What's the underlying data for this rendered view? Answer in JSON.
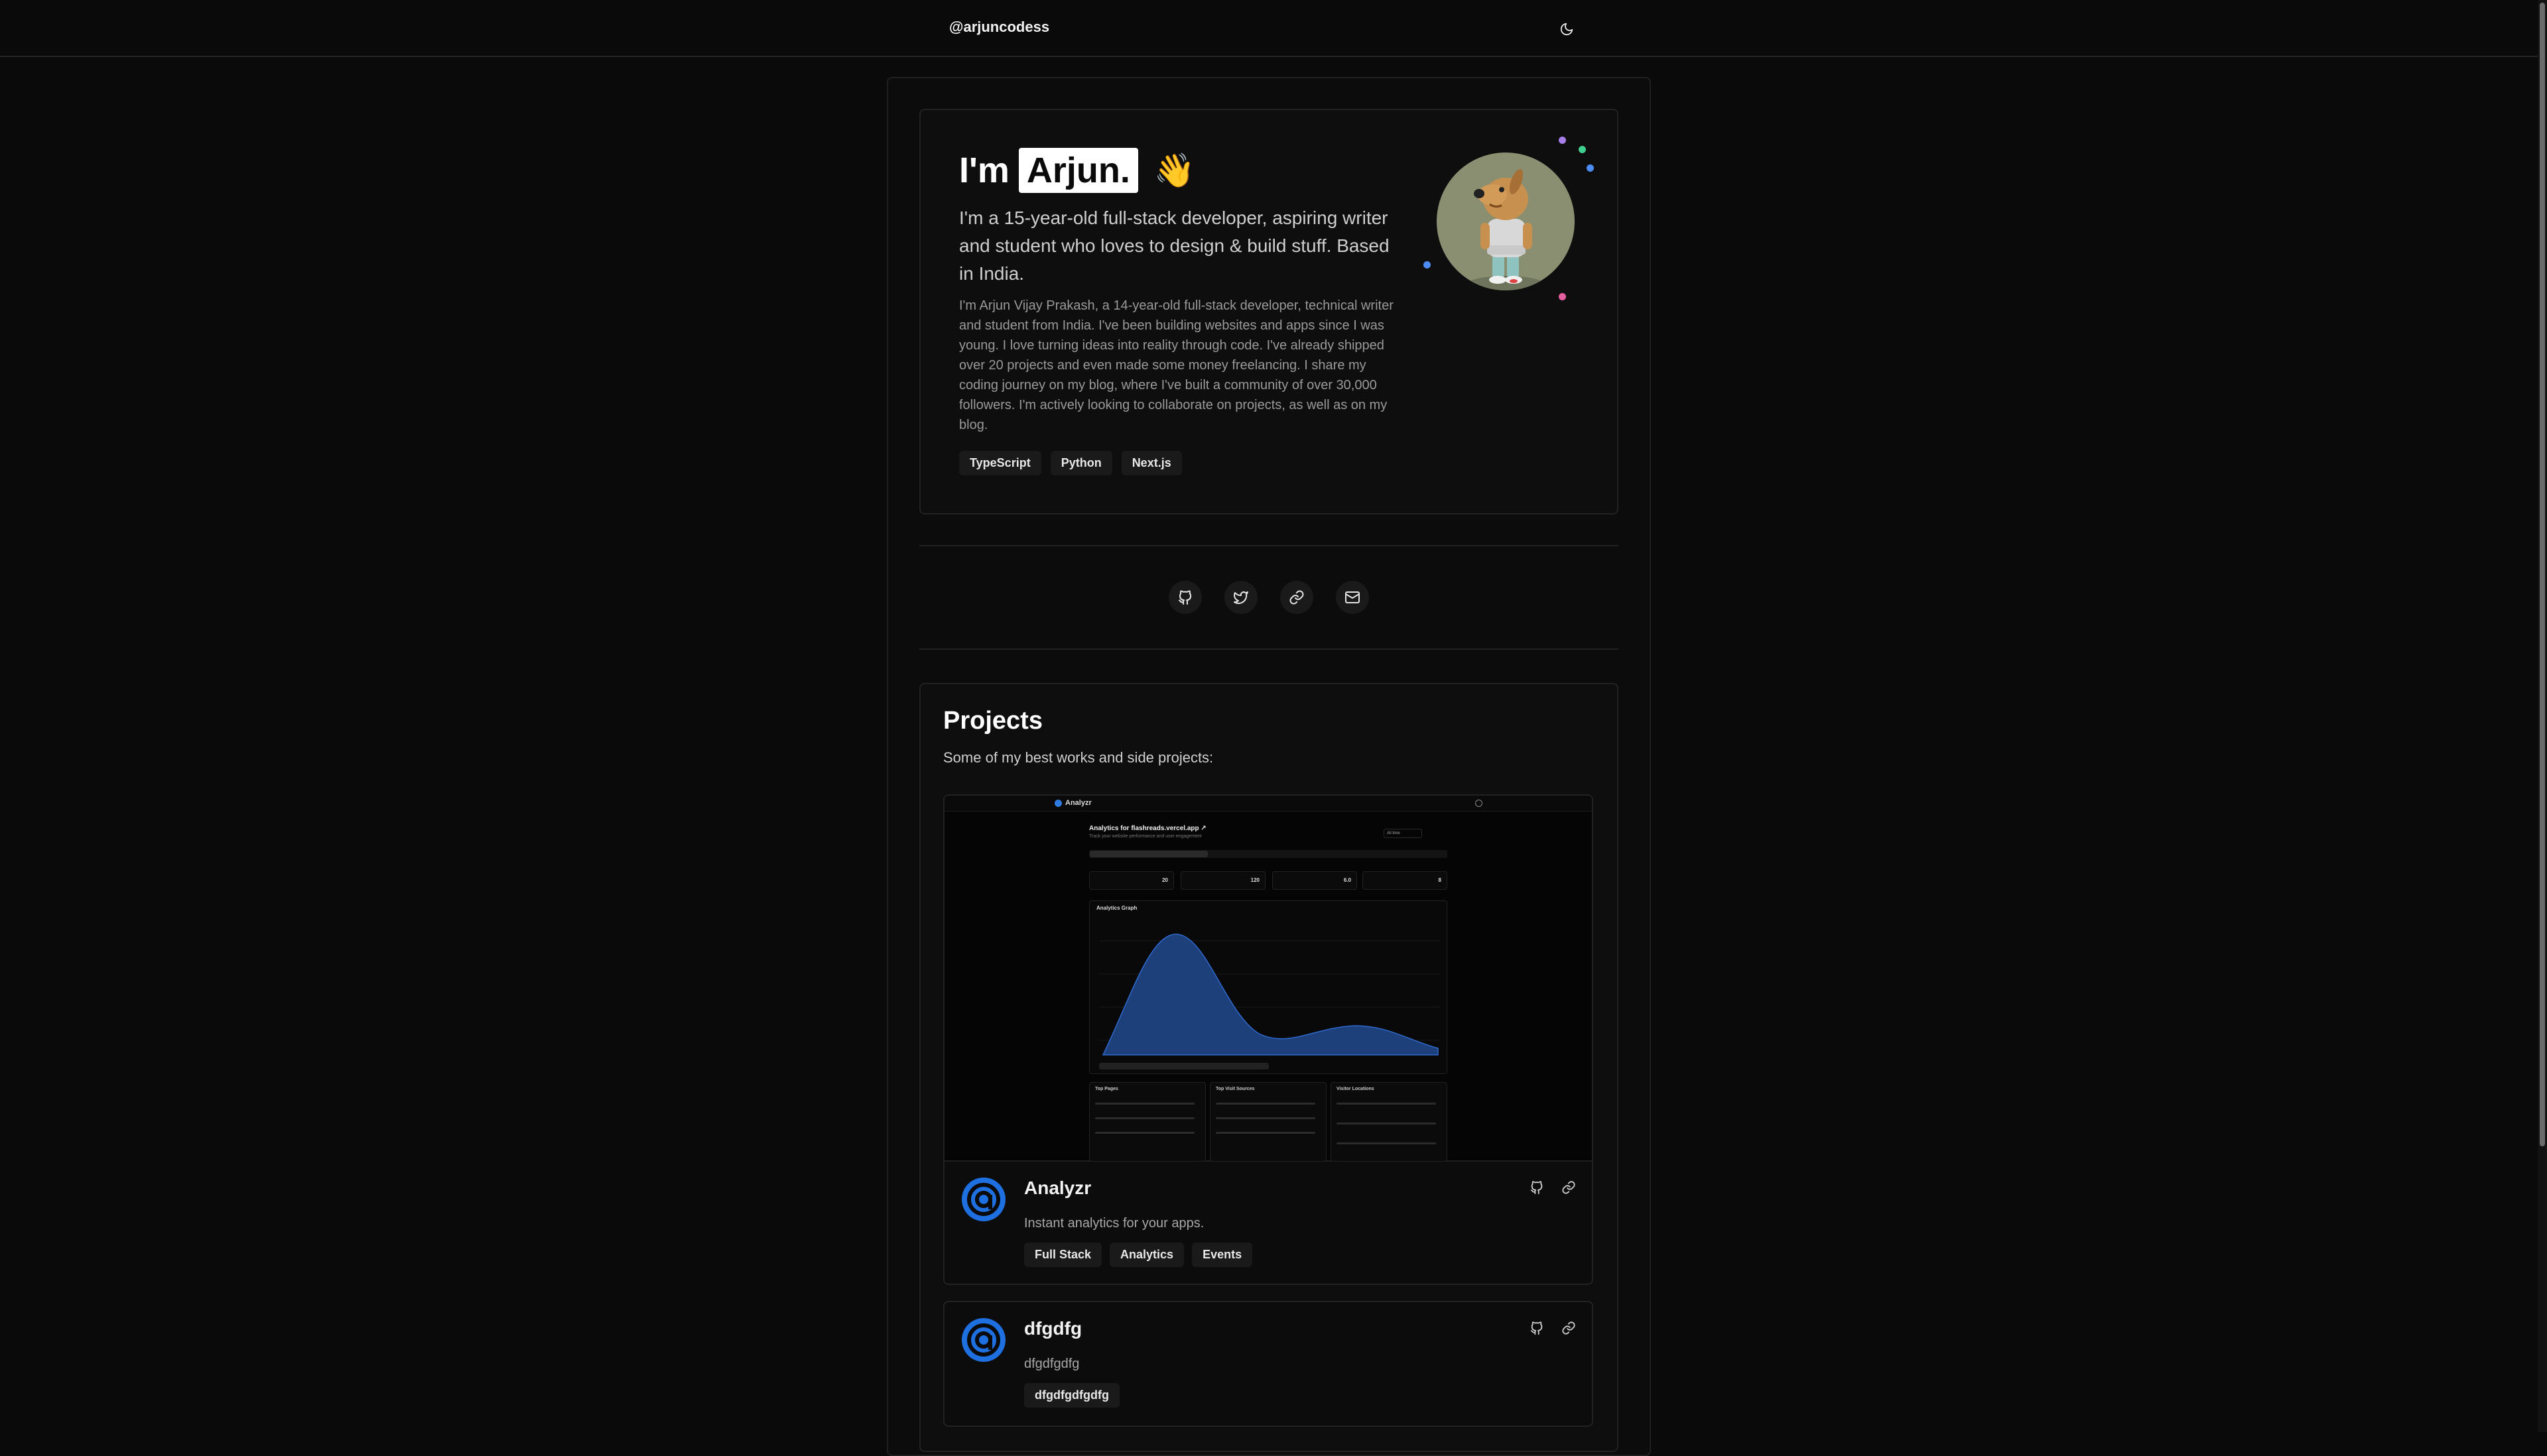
{
  "header": {
    "handle": "@arjuncodess",
    "theme_toggle_icon": "moon-icon"
  },
  "hero": {
    "greeting": "I'm",
    "name": "Arjun.",
    "wave": "👋",
    "lead": "I'm a 15-year-old full-stack developer, aspiring writer and student who loves to design & build stuff. Based in India.",
    "bio": "I'm Arjun Vijay Prakash, a 14-year-old full-stack developer, technical writer and student from India. I've been building websites and apps since I was young. I love turning ideas into reality through code. I've already shipped over 20 projects and even made some money freelancing. I share my coding journey on my blog, where I've built a community of over 30,000 followers. I'm actively looking to collaborate on projects, as well as on my blog.",
    "tags": [
      "TypeScript",
      "Python",
      "Next.js"
    ],
    "avatar_icon": "dog-character-avatar"
  },
  "socials": [
    {
      "icon": "github-icon"
    },
    {
      "icon": "twitter-icon"
    },
    {
      "icon": "link-icon"
    },
    {
      "icon": "mail-icon"
    }
  ],
  "projects": {
    "title": "Projects",
    "subtitle": "Some of my best works and side projects:",
    "items": [
      {
        "name": "Analyzr",
        "description": "Instant analytics for your apps.",
        "tags": [
          "Full Stack",
          "Analytics",
          "Events"
        ],
        "preview": {
          "brand": "Analyzr",
          "title": "Analytics for flashreads.vercel.app ↗",
          "subtitle": "Track your website performance and user engagement",
          "select": "All time",
          "graph_label": "Analytics Graph",
          "stats": [
            "20",
            "120",
            "6.0",
            "8"
          ],
          "panels": [
            "Top Pages",
            "Top Visit Sources",
            "Visitor Locations"
          ]
        }
      },
      {
        "name": "dfgdfg",
        "description": "dfgdfgdfg",
        "tags": [
          "dfgdfgdfgdfg"
        ]
      }
    ]
  },
  "colors": {
    "background": "#0a0a0a",
    "accent_blue": "#1e6fe0",
    "chart_fill": "#1d3f7a"
  }
}
